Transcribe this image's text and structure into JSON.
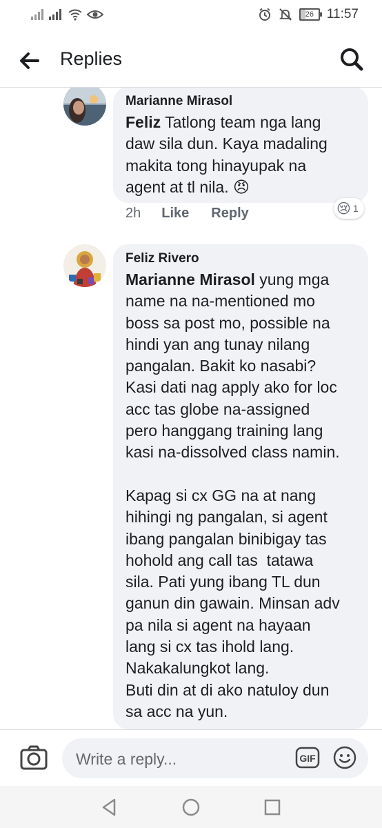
{
  "status_bar": {
    "battery_level": "26",
    "battery_fraction": 0.26,
    "time": "11:57"
  },
  "header": {
    "title": "Replies"
  },
  "comments": [
    {
      "author": "Marianne Mirasol",
      "mention": "Feliz",
      "text": " Tatlong team nga lang\ndaw sila dun. Kaya madaling\nmakita tong hinayupak na\nagent at tl nila. ",
      "emoji": "😠",
      "age": "2h",
      "like_label": "Like",
      "reply_label": "Reply",
      "reaction_emoji": "😢",
      "reaction_count": "1"
    },
    {
      "author": "Feliz Rivero",
      "mention": "Marianne Mirasol",
      "text": " yung mga\nname na na-mentioned mo\nboss sa post mo, possible na\nhindi yan ang tunay nilang\npangalan. Bakit ko nasabi?\nKasi dati nag apply ako for loc\nacc tas globe na-assigned\npero hanggang training lang\nkasi na-dissolved class namin.\n\nKapag si cx GG na at nang\nhihingi ng pangalan, si agent\nibang pangalan binibigay tas\nhohold ang call tas  tatawa\nsila. Pati yung ibang TL dun\nganun din gawain. Minsan adv\npa nila si agent na hayaan\nlang si cx tas ihold lang.\nNakakalungkot lang.\nButi din at di ako natuloy dun\nsa acc na yun."
    }
  ],
  "composer": {
    "placeholder": "Write a reply...",
    "gif_label": "GIF"
  },
  "icons": [
    "back-arrow-icon",
    "search-icon",
    "camera-icon",
    "gif-icon",
    "emoji-icon",
    "nav-back-icon",
    "nav-home-icon",
    "nav-recents-icon",
    "signal-icon",
    "wifi-icon",
    "eye-icon",
    "alarm-icon",
    "mute-icon"
  ],
  "colors": {
    "bubble": "#f0f2f5",
    "text": "#1c1e21",
    "secondary": "#606770"
  }
}
